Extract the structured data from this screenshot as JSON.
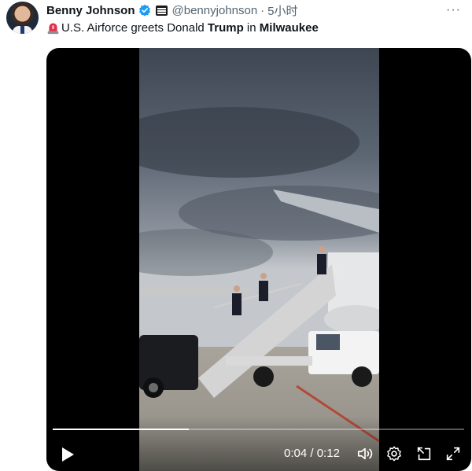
{
  "tweet": {
    "author_name": "Benny Johnson",
    "handle": "@bennyjohnson",
    "separator": "·",
    "time_ago": "5小时",
    "more_label": "···",
    "text_prefix": "U.S. Airforce greets Donald ",
    "text_bold_1": "Trump",
    "text_mid": " in ",
    "text_bold_2": "Milwaukee"
  },
  "video": {
    "current_time": "0:04",
    "time_separator": " / ",
    "duration": "0:12",
    "progress_fraction": 0.33
  },
  "colors": {
    "verified_blue": "#1d9bf0",
    "siren_red": "#e0314b",
    "muted_text": "#536471"
  }
}
